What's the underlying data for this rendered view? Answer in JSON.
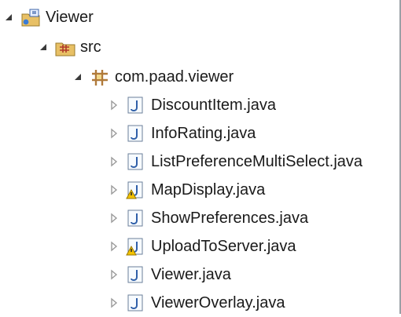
{
  "tree": {
    "project": {
      "label": "Viewer",
      "icon": "java-project-icon",
      "expanded": true
    },
    "src": {
      "label": "src",
      "icon": "source-folder-icon",
      "expanded": true
    },
    "package": {
      "label": "com.paad.viewer",
      "icon": "package-icon",
      "expanded": true
    },
    "files": [
      {
        "label": "DiscountItem.java",
        "icon": "java-file-icon",
        "warning": false,
        "expanded": false
      },
      {
        "label": "InfoRating.java",
        "icon": "java-file-icon",
        "warning": false,
        "expanded": false
      },
      {
        "label": "ListPreferenceMultiSelect.java",
        "icon": "java-file-icon",
        "warning": false,
        "expanded": false
      },
      {
        "label": "MapDisplay.java",
        "icon": "java-file-warning-icon",
        "warning": true,
        "expanded": false
      },
      {
        "label": "ShowPreferences.java",
        "icon": "java-file-icon",
        "warning": false,
        "expanded": false
      },
      {
        "label": "UploadToServer.java",
        "icon": "java-file-warning-icon",
        "warning": true,
        "expanded": false
      },
      {
        "label": "Viewer.java",
        "icon": "java-file-icon",
        "warning": false,
        "expanded": false
      },
      {
        "label": "ViewerOverlay.java",
        "icon": "java-file-icon",
        "warning": false,
        "expanded": false
      }
    ]
  },
  "colors": {
    "twisty_expanded": "#3a3a3a",
    "twisty_collapsed": "#9a9a9a",
    "java_icon_blue": "#2f5fa8",
    "warning_yellow": "#f2c200",
    "package_brown": "#b07a3a"
  }
}
